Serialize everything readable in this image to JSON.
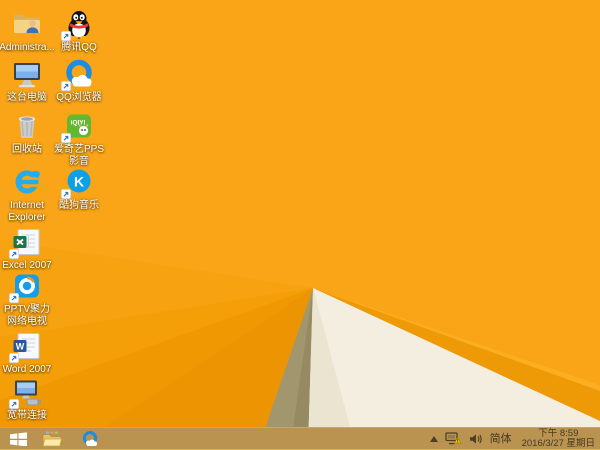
{
  "desktop": {
    "icons": [
      {
        "name": "administrator-folder",
        "icon": "user-folder",
        "label": "Administra...",
        "col": 1,
        "row": 1,
        "shortcut": false,
        "wrap": false
      },
      {
        "name": "tencent-qq",
        "icon": "qq-penguin",
        "label": "腾讯QQ",
        "col": 2,
        "row": 1,
        "shortcut": true,
        "wrap": false
      },
      {
        "name": "this-pc",
        "icon": "computer",
        "label": "这台电脑",
        "col": 1,
        "row": 2,
        "shortcut": false,
        "wrap": false
      },
      {
        "name": "qq-browser",
        "icon": "qq-browser",
        "label": "QQ浏览器",
        "col": 2,
        "row": 2,
        "shortcut": true,
        "wrap": false
      },
      {
        "name": "recycle-bin",
        "icon": "recycle-bin",
        "label": "回收站",
        "col": 1,
        "row": 3,
        "shortcut": false,
        "wrap": false
      },
      {
        "name": "iqiyi-pps",
        "icon": "iqiyi",
        "label": "爱奇艺PPS 影音",
        "col": 2,
        "row": 3,
        "shortcut": true,
        "wrap": true
      },
      {
        "name": "internet-explorer",
        "icon": "ie",
        "label": "Internet Explorer",
        "col": 1,
        "row": 4,
        "shortcut": false,
        "wrap": true
      },
      {
        "name": "kugou-music",
        "icon": "kugou",
        "label": "酷狗音乐",
        "col": 2,
        "row": 4,
        "shortcut": true,
        "wrap": false
      },
      {
        "name": "excel-2007",
        "icon": "excel",
        "label": "Excel 2007",
        "col": 1,
        "row": 5,
        "shortcut": true,
        "wrap": false
      },
      {
        "name": "pptv",
        "icon": "pptv",
        "label": "PPTV聚力 网络电视",
        "col": 1,
        "row": 6,
        "shortcut": true,
        "wrap": true
      },
      {
        "name": "word-2007",
        "icon": "word",
        "label": "Word 2007",
        "col": 1,
        "row": 7,
        "shortcut": true,
        "wrap": false
      },
      {
        "name": "broadband-connection",
        "icon": "broadband",
        "label": "宽带连接",
        "col": 1,
        "row": 8,
        "shortcut": true,
        "wrap": false
      }
    ]
  },
  "taskbar": {
    "pinned_icons": [
      "start",
      "file-explorer",
      "qq-browser"
    ],
    "tray_icons": [
      "hidden-icons-arrow",
      "network-warning",
      "volume"
    ],
    "input_language": "简体",
    "clock": {
      "time": "下午 8:59",
      "date": "2016/3/27 星期日"
    }
  },
  "colors": {
    "wallpaper_orange": "#F9A517",
    "wallpaper_dark_facet": "#EC9402",
    "wallpaper_shadow": "#A2966E",
    "wallpaper_cream": "#F3EEDF",
    "taskbar": "#BB9350",
    "tray_text": "#453A22",
    "label_text": "#FFFFFF",
    "qq_blue": "#1E8DE0"
  }
}
